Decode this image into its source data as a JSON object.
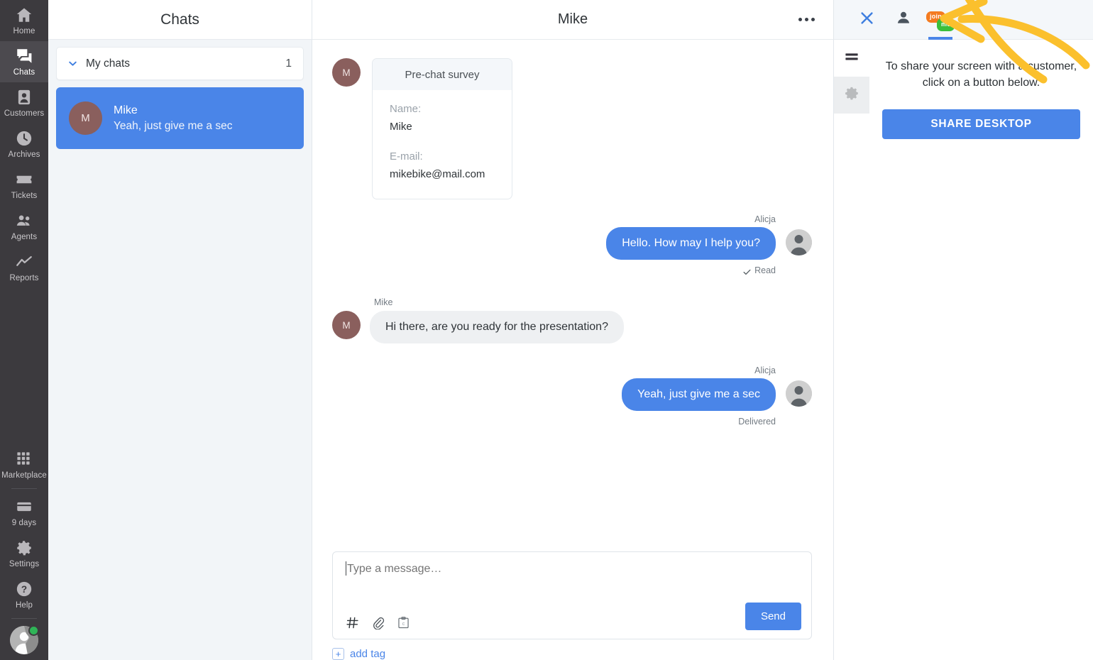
{
  "nav": {
    "items": [
      {
        "label": "Home",
        "icon": "home-icon",
        "active": false
      },
      {
        "label": "Chats",
        "icon": "chats-icon",
        "active": true
      },
      {
        "label": "Customers",
        "icon": "customers-icon",
        "active": false
      },
      {
        "label": "Archives",
        "icon": "archives-clock-icon",
        "active": false
      },
      {
        "label": "Tickets",
        "icon": "tickets-icon",
        "active": false
      },
      {
        "label": "Agents",
        "icon": "agents-icon",
        "active": false
      },
      {
        "label": "Reports",
        "icon": "reports-chart-icon",
        "active": false
      }
    ],
    "bottom_items": [
      {
        "label": "Marketplace",
        "icon": "marketplace-grid-icon"
      },
      {
        "label": "9 days",
        "icon": "billing-card-icon"
      },
      {
        "label": "Settings",
        "icon": "gear-icon"
      },
      {
        "label": "Help",
        "icon": "help-question-icon"
      }
    ],
    "avatar_status": "online"
  },
  "chatlist": {
    "title": "Chats",
    "group": {
      "label": "My chats",
      "count": "1",
      "expanded": true
    },
    "items": [
      {
        "initial": "M",
        "name": "Mike",
        "preview": "Yeah, just give me a sec",
        "selected": true
      }
    ]
  },
  "conversation": {
    "title": "Mike",
    "more_icon": "ellipsis-icon",
    "survey": {
      "heading": "Pre-chat survey",
      "fields": [
        {
          "label": "Name:",
          "value": "Mike"
        },
        {
          "label": "E-mail:",
          "value": "mikebike@mail.com"
        }
      ],
      "avatar_initial": "M"
    },
    "messages": [
      {
        "side": "right",
        "sender": "Alicja",
        "text": "Hello. How may I help you?",
        "status": "Read",
        "status_icon": "check-icon"
      },
      {
        "side": "left",
        "sender": "Mike",
        "text": "Hi there, are you ready for the presentation?",
        "avatar_initial": "M",
        "status": ""
      },
      {
        "side": "right",
        "sender": "Alicja",
        "text": "Yeah, just give me a sec",
        "status": "Delivered",
        "status_icon": ""
      }
    ],
    "composer": {
      "placeholder": "Type a message…",
      "value": "",
      "send_label": "Send",
      "tools": [
        {
          "icon": "hash-icon",
          "name": "tag-shortcut"
        },
        {
          "icon": "paperclip-icon",
          "name": "attach-file"
        },
        {
          "icon": "canned-response-icon",
          "name": "canned-responses"
        }
      ]
    },
    "tag": {
      "plus": "+",
      "label": "add tag"
    }
  },
  "right_panel": {
    "tabs": [
      {
        "icon": "close-x-icon",
        "name": "close-panel",
        "active": false
      },
      {
        "icon": "customer-person-icon",
        "name": "customer-details",
        "active": false
      },
      {
        "icon": "joinme-logo-icon",
        "name": "joinme-app",
        "active": true,
        "logo": {
          "first": "join",
          "second": "me"
        }
      }
    ],
    "side_icons": [
      {
        "icon": "hamburger-icon",
        "name": "joinme-menu",
        "shaded": false
      },
      {
        "icon": "gear-icon",
        "name": "joinme-settings",
        "shaded": true
      }
    ],
    "instruction": "To share your screen with a customer, click on a button below.",
    "cta_label": "SHARE DESKTOP"
  },
  "annotation": {
    "type": "arrow",
    "color": "#fbc02d",
    "points_to": "joinme-app-tab"
  },
  "colors": {
    "accent_blue": "#4a85e8",
    "rail_dark": "#3c3a3e",
    "panel_bg": "#f2f5f8",
    "joinme_orange": "#f47b20",
    "joinme_green": "#3bbf3b",
    "status_green": "#2fb457",
    "annotation_yellow": "#fbc02d"
  }
}
